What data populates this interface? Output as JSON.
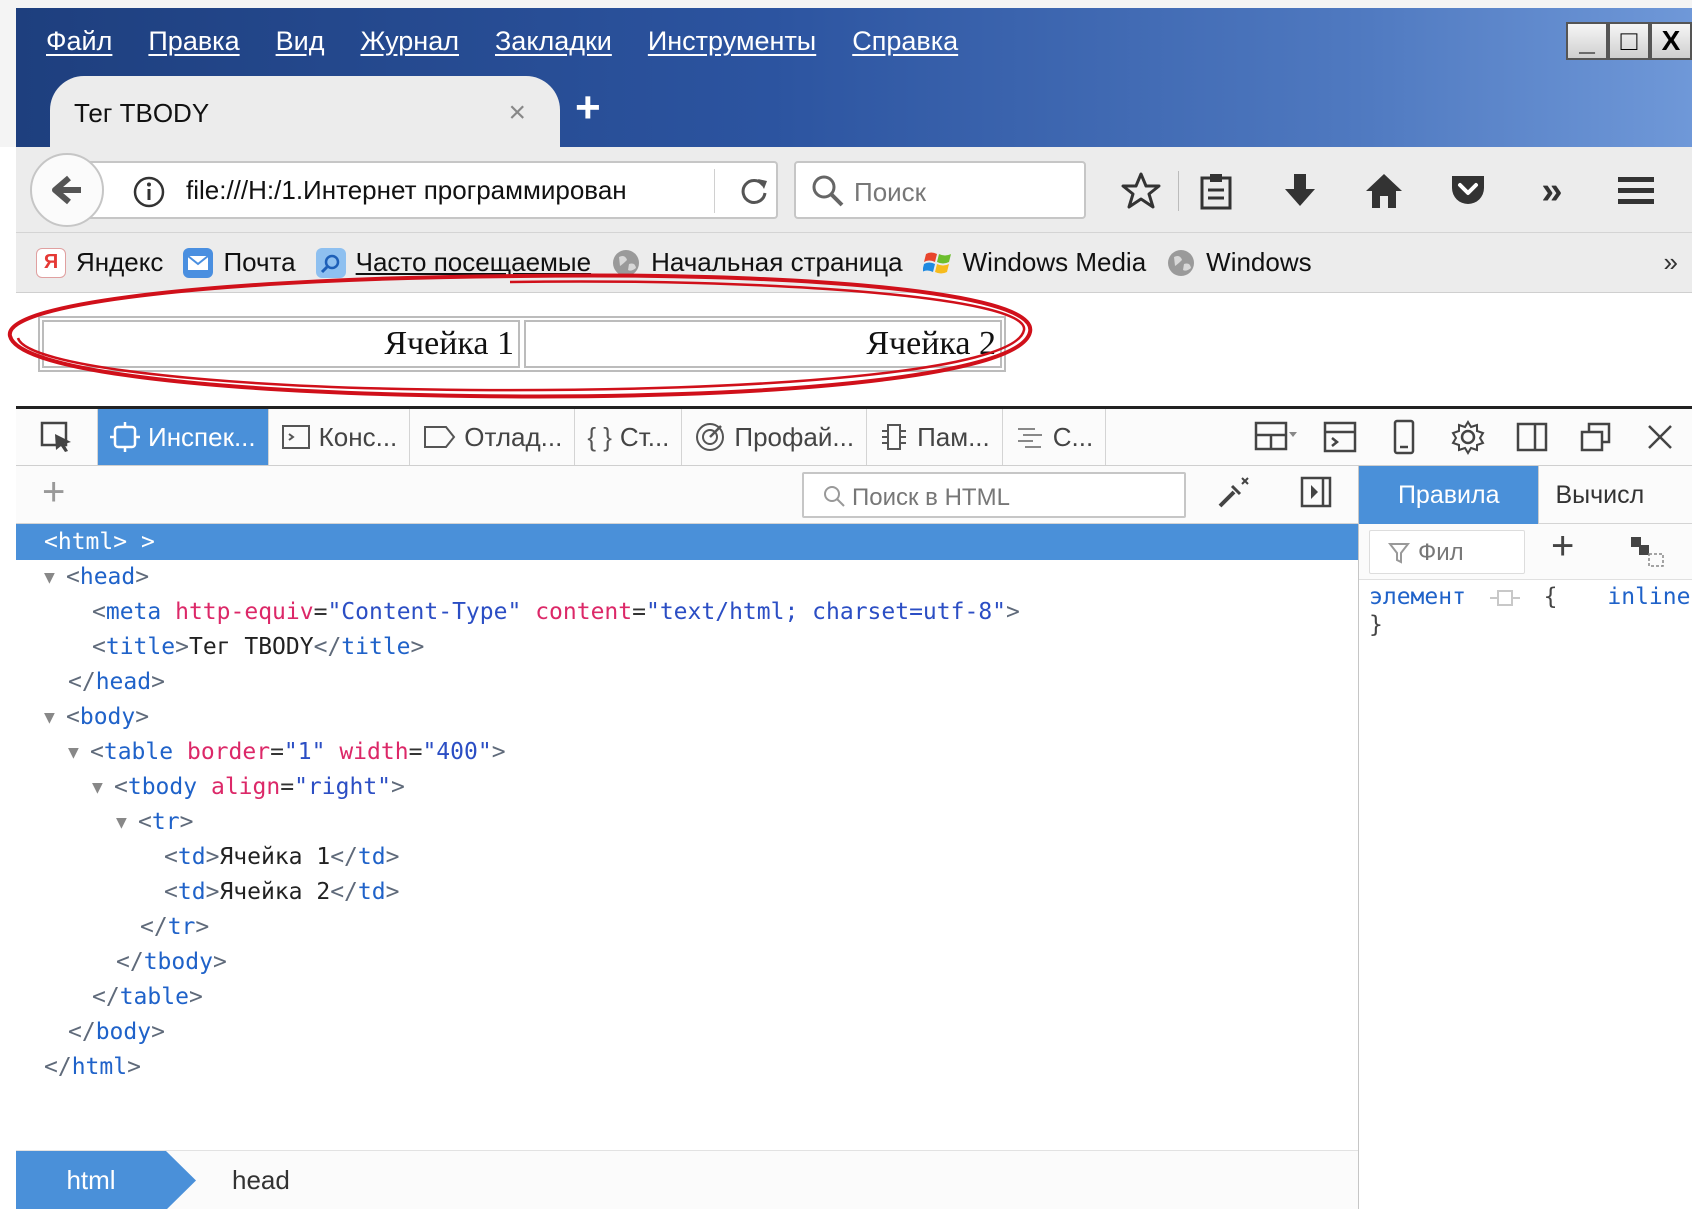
{
  "menubar": [
    "Файл",
    "Правка",
    "Вид",
    "Журнал",
    "Закладки",
    "Инструменты",
    "Справка"
  ],
  "window_controls": [
    "_",
    "□",
    "X"
  ],
  "tab": {
    "title": "Тег TBODY",
    "close": "×",
    "new_tab": "+"
  },
  "navbar": {
    "url": "file:///H:/1.Интернет программирован",
    "search_placeholder": "Поиск",
    "overflow": "»"
  },
  "bookmarks": {
    "items": [
      {
        "label": "Яндекс",
        "icon": "yandex-icon",
        "color": "#e53935"
      },
      {
        "label": "Почта",
        "icon": "mail-icon",
        "color": "#4a8fe0"
      },
      {
        "label": "Часто посещаемые",
        "icon": "frequent-folder-icon",
        "color": "#5a9fe0"
      },
      {
        "label": "Начальная страница",
        "icon": "globe-icon",
        "color": "#8a8a8a"
      },
      {
        "label": "Windows Media",
        "icon": "windows-logo-icon",
        "color": "#f0a020"
      },
      {
        "label": "Windows",
        "icon": "globe-icon",
        "color": "#8a8a8a"
      }
    ],
    "overflow": "»"
  },
  "page": {
    "cells": [
      "Ячейка 1",
      "Ячейка 2"
    ],
    "annotation_color": "#d0101a"
  },
  "devtools": {
    "tabs": [
      {
        "label": "Инспек...",
        "icon": "inspector-icon",
        "active": true
      },
      {
        "label": "Конс...",
        "icon": "console-icon"
      },
      {
        "label": "Отлад...",
        "icon": "debugger-icon"
      },
      {
        "label": "Ст...",
        "icon": "style-editor-icon",
        "prefix": "{ }"
      },
      {
        "label": "Профай...",
        "icon": "profiler-icon"
      },
      {
        "label": "Пам...",
        "icon": "memory-icon"
      },
      {
        "label": "С...",
        "icon": "network-icon"
      }
    ],
    "html_search_placeholder": "Поиск в HTML",
    "side_tabs": [
      "Правила",
      "Вычисл"
    ],
    "rule_filter_placeholder": "Фил",
    "rule": {
      "selector": "элемент",
      "open": "{",
      "source": "inline",
      "close": "}"
    },
    "breadcrumbs": [
      "html",
      "head"
    ],
    "accent": "#4a90d9"
  },
  "markup": {
    "l0": {
      "open": "<",
      "tag": "html",
      "close": ">",
      "after": " >"
    },
    "l1": {
      "open": "<",
      "tag": "head",
      "close": ">"
    },
    "l2": {
      "open": "<",
      "tag": "meta",
      "a1": "http-equiv",
      "v1": "\"Content-Type\"",
      "a2": "content",
      "v2": "\"text/html; charset=utf-8\"",
      "close": ">"
    },
    "l3": {
      "open": "<",
      "tag": "title",
      "close": ">",
      "text": "Тег TBODY",
      "end_open": "</",
      "end_tag": "title",
      "end_close": ">"
    },
    "l4": {
      "open": "</",
      "tag": "head",
      "close": ">"
    },
    "l5": {
      "open": "<",
      "tag": "body",
      "close": ">"
    },
    "l6": {
      "open": "<",
      "tag": "table",
      "a1": "border",
      "v1": "\"1\"",
      "a2": "width",
      "v2": "\"400\"",
      "close": ">"
    },
    "l7": {
      "open": "<",
      "tag": "tbody",
      "a1": "align",
      "v1": "\"right\"",
      "close": ">"
    },
    "l8": {
      "open": "<",
      "tag": "tr",
      "close": ">"
    },
    "l9": {
      "open": "<",
      "tag": "td",
      "close": ">",
      "text": "Ячейка 1",
      "end_open": "</",
      "end_tag": "td",
      "end_close": ">"
    },
    "l10": {
      "open": "<",
      "tag": "td",
      "close": ">",
      "text": "Ячейка 2",
      "end_open": "</",
      "end_tag": "td",
      "end_close": ">"
    },
    "l11": {
      "open": "</",
      "tag": "tr",
      "close": ">"
    },
    "l12": {
      "open": "</",
      "tag": "tbody",
      "close": ">"
    },
    "l13": {
      "open": "</",
      "tag": "table",
      "close": ">"
    },
    "l14": {
      "open": "</",
      "tag": "body",
      "close": ">"
    },
    "l15": {
      "open": "</",
      "tag": "html",
      "close": ">"
    }
  }
}
